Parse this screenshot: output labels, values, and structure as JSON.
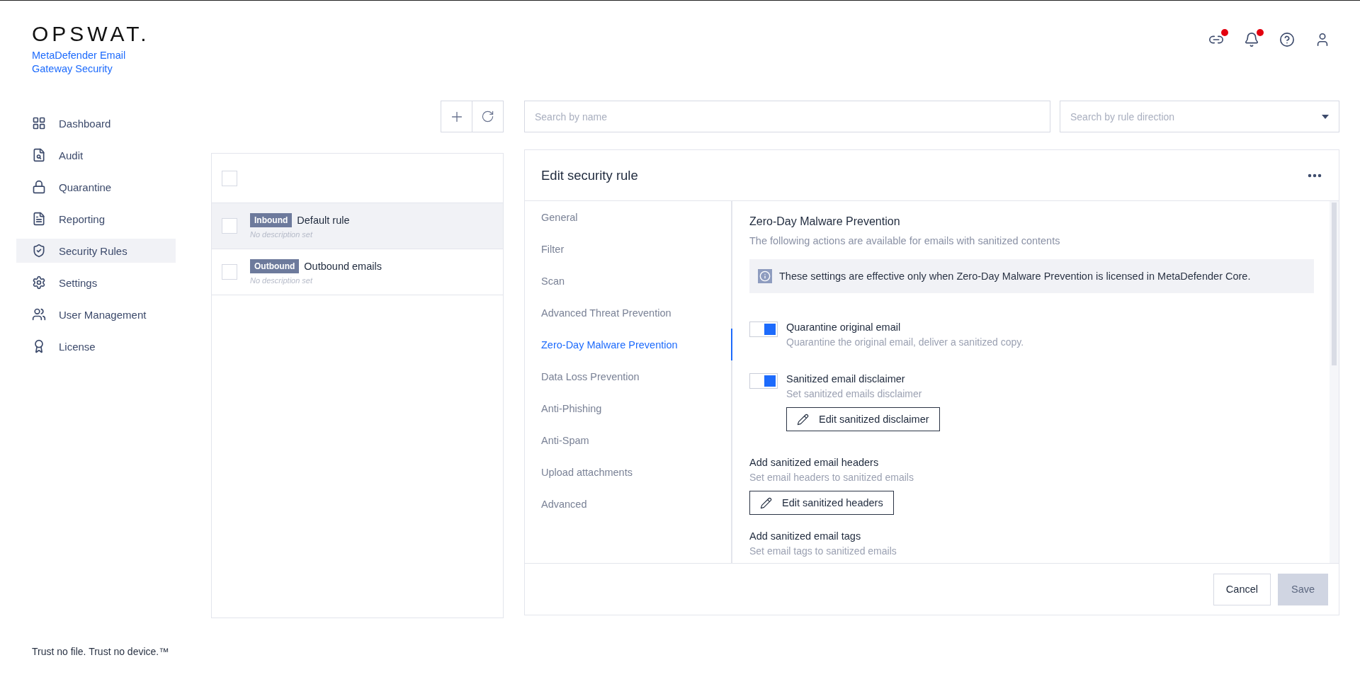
{
  "brand": {
    "logo": "OPSWAT.",
    "product": "MetaDefender Email Gateway Security"
  },
  "header_icons": [
    {
      "kind": "integrations",
      "alert": true
    },
    {
      "kind": "notifications",
      "alert": true
    },
    {
      "kind": "help",
      "alert": false
    },
    {
      "kind": "account",
      "alert": false
    }
  ],
  "sidebar": {
    "items": [
      {
        "kind": "dashboard",
        "label": "Dashboard",
        "selected": false
      },
      {
        "kind": "audit",
        "label": "Audit",
        "selected": false
      },
      {
        "kind": "quarantine",
        "label": "Quarantine",
        "selected": false
      },
      {
        "kind": "reporting",
        "label": "Reporting",
        "selected": false
      },
      {
        "kind": "rules",
        "label": "Security Rules",
        "selected": true
      },
      {
        "kind": "settings",
        "label": "Settings",
        "selected": false
      },
      {
        "kind": "users",
        "label": "User Management",
        "selected": false
      },
      {
        "kind": "license",
        "label": "License",
        "selected": false
      }
    ],
    "footer": "Trust no file. Trust no device.™"
  },
  "rules": {
    "select_all_checked": false,
    "items": [
      {
        "direction": "Inbound",
        "name": "Default rule",
        "description": "No description set",
        "selected": true,
        "checked": false
      },
      {
        "direction": "Outbound",
        "name": "Outbound emails",
        "description": "No description set",
        "selected": false,
        "checked": false
      }
    ]
  },
  "search": {
    "placeholder": "Search by name"
  },
  "direction_filter": {
    "placeholder": "Search by rule direction"
  },
  "editor": {
    "title": "Edit security rule",
    "nav": [
      {
        "label": "General",
        "selected": false
      },
      {
        "label": "Filter",
        "selected": false
      },
      {
        "label": "Scan",
        "selected": false
      },
      {
        "label": "Advanced Threat Prevention",
        "selected": false
      },
      {
        "label": "Zero-Day Malware Prevention",
        "selected": true
      },
      {
        "label": "Data Loss Prevention",
        "selected": false
      },
      {
        "label": "Anti-Phishing",
        "selected": false
      },
      {
        "label": "Anti-Spam",
        "selected": false
      },
      {
        "label": "Upload attachments",
        "selected": false
      },
      {
        "label": "Advanced",
        "selected": false
      }
    ],
    "section_title": "Zero-Day Malware Prevention",
    "section_description": "The following actions are available for emails with sanitized contents",
    "notice": "These settings are effective only when Zero-Day Malware Prevention is licensed in MetaDefender Core.",
    "settings": [
      {
        "kind": "toggle",
        "title": "Quarantine original email",
        "description": "Quarantine the original email, deliver a sanitized copy.",
        "on": true
      },
      {
        "kind": "toggle",
        "title": "Sanitized email disclaimer",
        "description": "Set sanitized emails disclaimer",
        "on": true,
        "button": "Edit sanitized disclaimer"
      },
      {
        "kind": "plain",
        "title": "Add sanitized email headers",
        "description": "Set email headers to sanitized emails",
        "button": "Edit sanitized headers"
      },
      {
        "kind": "plain",
        "title": "Add sanitized email tags",
        "description": "Set email tags to sanitized emails"
      }
    ],
    "cancel": "Cancel",
    "save": {
      "label": "Save",
      "disabled": true
    }
  }
}
